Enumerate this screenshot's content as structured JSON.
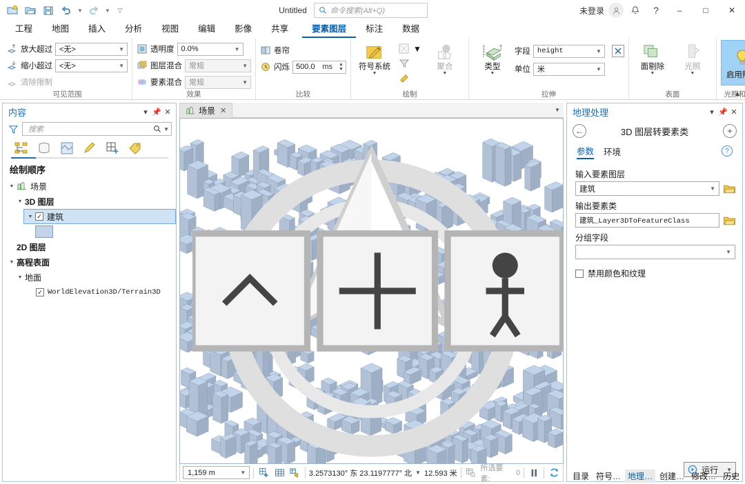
{
  "titlebar": {
    "quick_access": [
      {
        "name": "new-project-icon",
        "label": "新建工程"
      },
      {
        "name": "open-project-icon",
        "label": "打开工程"
      },
      {
        "name": "save-project-icon",
        "label": "保存工程"
      },
      {
        "name": "undo-icon",
        "label": "撤销"
      },
      {
        "name": "redo-icon",
        "label": "重做"
      },
      {
        "name": "customize-qat-icon",
        "label": "自定义快速访问工具栏"
      }
    ],
    "doc_title": "Untitled",
    "search_placeholder": "命令搜索(Alt+Q)",
    "account_label": "未登录",
    "notifications_label": "通知",
    "help_label": "帮助",
    "window": {
      "minimize": "–",
      "maximize": "□",
      "close": "✕"
    }
  },
  "ribbon_tabs": {
    "standard": [
      "工程",
      "地图",
      "插入",
      "分析",
      "视图",
      "编辑",
      "影像",
      "共享"
    ],
    "contextual": [
      "要素图层",
      "标注",
      "数据"
    ],
    "active": "要素图层"
  },
  "ribbon": {
    "groups": [
      {
        "name": "visible-range",
        "label": "可见范围",
        "items": [
          {
            "label": "放大超过",
            "value": "<无>"
          },
          {
            "label": "缩小超过",
            "value": "<无>"
          },
          {
            "label": "清除限制",
            "disabled": true
          }
        ]
      },
      {
        "name": "effects",
        "label": "效果",
        "items": [
          {
            "label": "透明度",
            "value": "0.0%"
          },
          {
            "label": "图层混合",
            "value": "常规",
            "disabled": true
          },
          {
            "label": "要素混合",
            "value": "常规",
            "disabled": true
          }
        ]
      },
      {
        "name": "compare",
        "label": "比较",
        "items": [
          {
            "label": "卷帘"
          },
          {
            "label": "闪烁",
            "value": "500.0",
            "unit": "ms"
          }
        ]
      },
      {
        "name": "drawing",
        "label": "绘制",
        "buttons": [
          {
            "label": "符号系统",
            "icon": "symbology-icon",
            "dropdown": true
          },
          {
            "label": "聚合",
            "icon": "aggregation-icon",
            "dropdown": true,
            "disabled": true
          }
        ],
        "small_icons": [
          "filter-icon",
          "display-filters-icon"
        ]
      },
      {
        "name": "extrusion",
        "label": "拉伸",
        "type_label": "类型",
        "fields": [
          {
            "label": "字段",
            "value": "height"
          },
          {
            "label": "单位",
            "value": "米"
          }
        ],
        "expression_button": "表达式"
      },
      {
        "name": "surface",
        "label": "表面",
        "buttons": [
          {
            "label": "面剔除",
            "icon": "face-culling-icon",
            "dropdown": true
          },
          {
            "label": "光照",
            "icon": "lighting-icon",
            "dropdown": true,
            "disabled": true
          }
        ]
      },
      {
        "name": "lighting-shadow",
        "label": "光照和阴影",
        "buttons": [
          {
            "label": "启用照明",
            "icon": "lightbulb-icon",
            "active": true
          }
        ]
      }
    ],
    "collapse_label": "折叠功能区"
  },
  "contents": {
    "title": "内容",
    "search_placeholder": "搜索",
    "tabs": [
      {
        "name": "list-by-drawing-order-icon",
        "active": true
      },
      {
        "name": "list-by-data-source-icon",
        "active": false
      },
      {
        "name": "list-by-selection-icon",
        "active": false
      },
      {
        "name": "list-by-editing-icon",
        "active": false
      },
      {
        "name": "list-by-snapping-icon",
        "active": false
      },
      {
        "name": "list-by-labeling-icon",
        "active": false
      }
    ],
    "tree_title": "绘制顺序",
    "tree": [
      {
        "label": "场景",
        "level": 0,
        "icon": "scene-icon",
        "expanded": true
      },
      {
        "label": "3D 图层",
        "level": 1,
        "expanded": true,
        "bold": true
      },
      {
        "label": "建筑",
        "level": 2,
        "checked": true,
        "selected": true,
        "expanded": true
      },
      {
        "label": "",
        "level": 3,
        "swatch": true
      },
      {
        "label": "2D 图层",
        "level": 1,
        "bold": true
      },
      {
        "label": "高程表面",
        "level": 0,
        "expanded": true,
        "bold": true
      },
      {
        "label": "地面",
        "level": 1,
        "expanded": true
      },
      {
        "label": "WorldElevation3D/Terrain3D",
        "level": 2,
        "checked": true,
        "mono": true
      }
    ]
  },
  "map": {
    "tab_label": "场景",
    "tab_icon": "scene-icon",
    "close_label": "关闭"
  },
  "statusbar": {
    "scale": "1,159 m",
    "tools": [
      "add-data-icon",
      "grid-icon",
      "explore-icon"
    ],
    "coordinates": "3.2573130° 东  23.1197777° 北",
    "elevation": "12.593 米",
    "selection_label": "所选要素:",
    "selection_count": "0",
    "pause_label": "暂停绘制",
    "refresh_label": "刷新"
  },
  "geoprocessing": {
    "title": "地理处理",
    "back_label": "返回",
    "tool_name": "3D 图层转要素类",
    "add_label": "添加到收藏夹",
    "tabs": [
      {
        "label": "参数",
        "active": true
      },
      {
        "label": "环境",
        "active": false
      }
    ],
    "help_label": "?",
    "fields": [
      {
        "name": "input-feature-layer",
        "label": "输入要素图层",
        "value": "建筑",
        "type": "combo",
        "browse": true
      },
      {
        "name": "output-feature-class",
        "label": "输出要素类",
        "value": "建筑_Layer3DToFeatureClass",
        "type": "text",
        "browse": true
      },
      {
        "name": "group-field",
        "label": "分组字段",
        "value": "",
        "type": "combo",
        "browse": false
      }
    ],
    "checkbox": {
      "label": "禁用颜色和纹理",
      "checked": false
    },
    "run_label": "运行",
    "bottom_tabs": [
      {
        "label": "目录",
        "active": false
      },
      {
        "label": "符号…",
        "active": false
      },
      {
        "label": "地理…",
        "active": true
      },
      {
        "label": "创建…",
        "active": false
      },
      {
        "label": "修改…",
        "active": false
      },
      {
        "label": "历史",
        "active": false
      }
    ]
  },
  "colors": {
    "accent": "#0b5ea8",
    "panel_border": "#a9c6dd",
    "building_fill": "#c2d4ea",
    "building_side": "#9fb0c6",
    "highlight": "#9fd2f5"
  }
}
